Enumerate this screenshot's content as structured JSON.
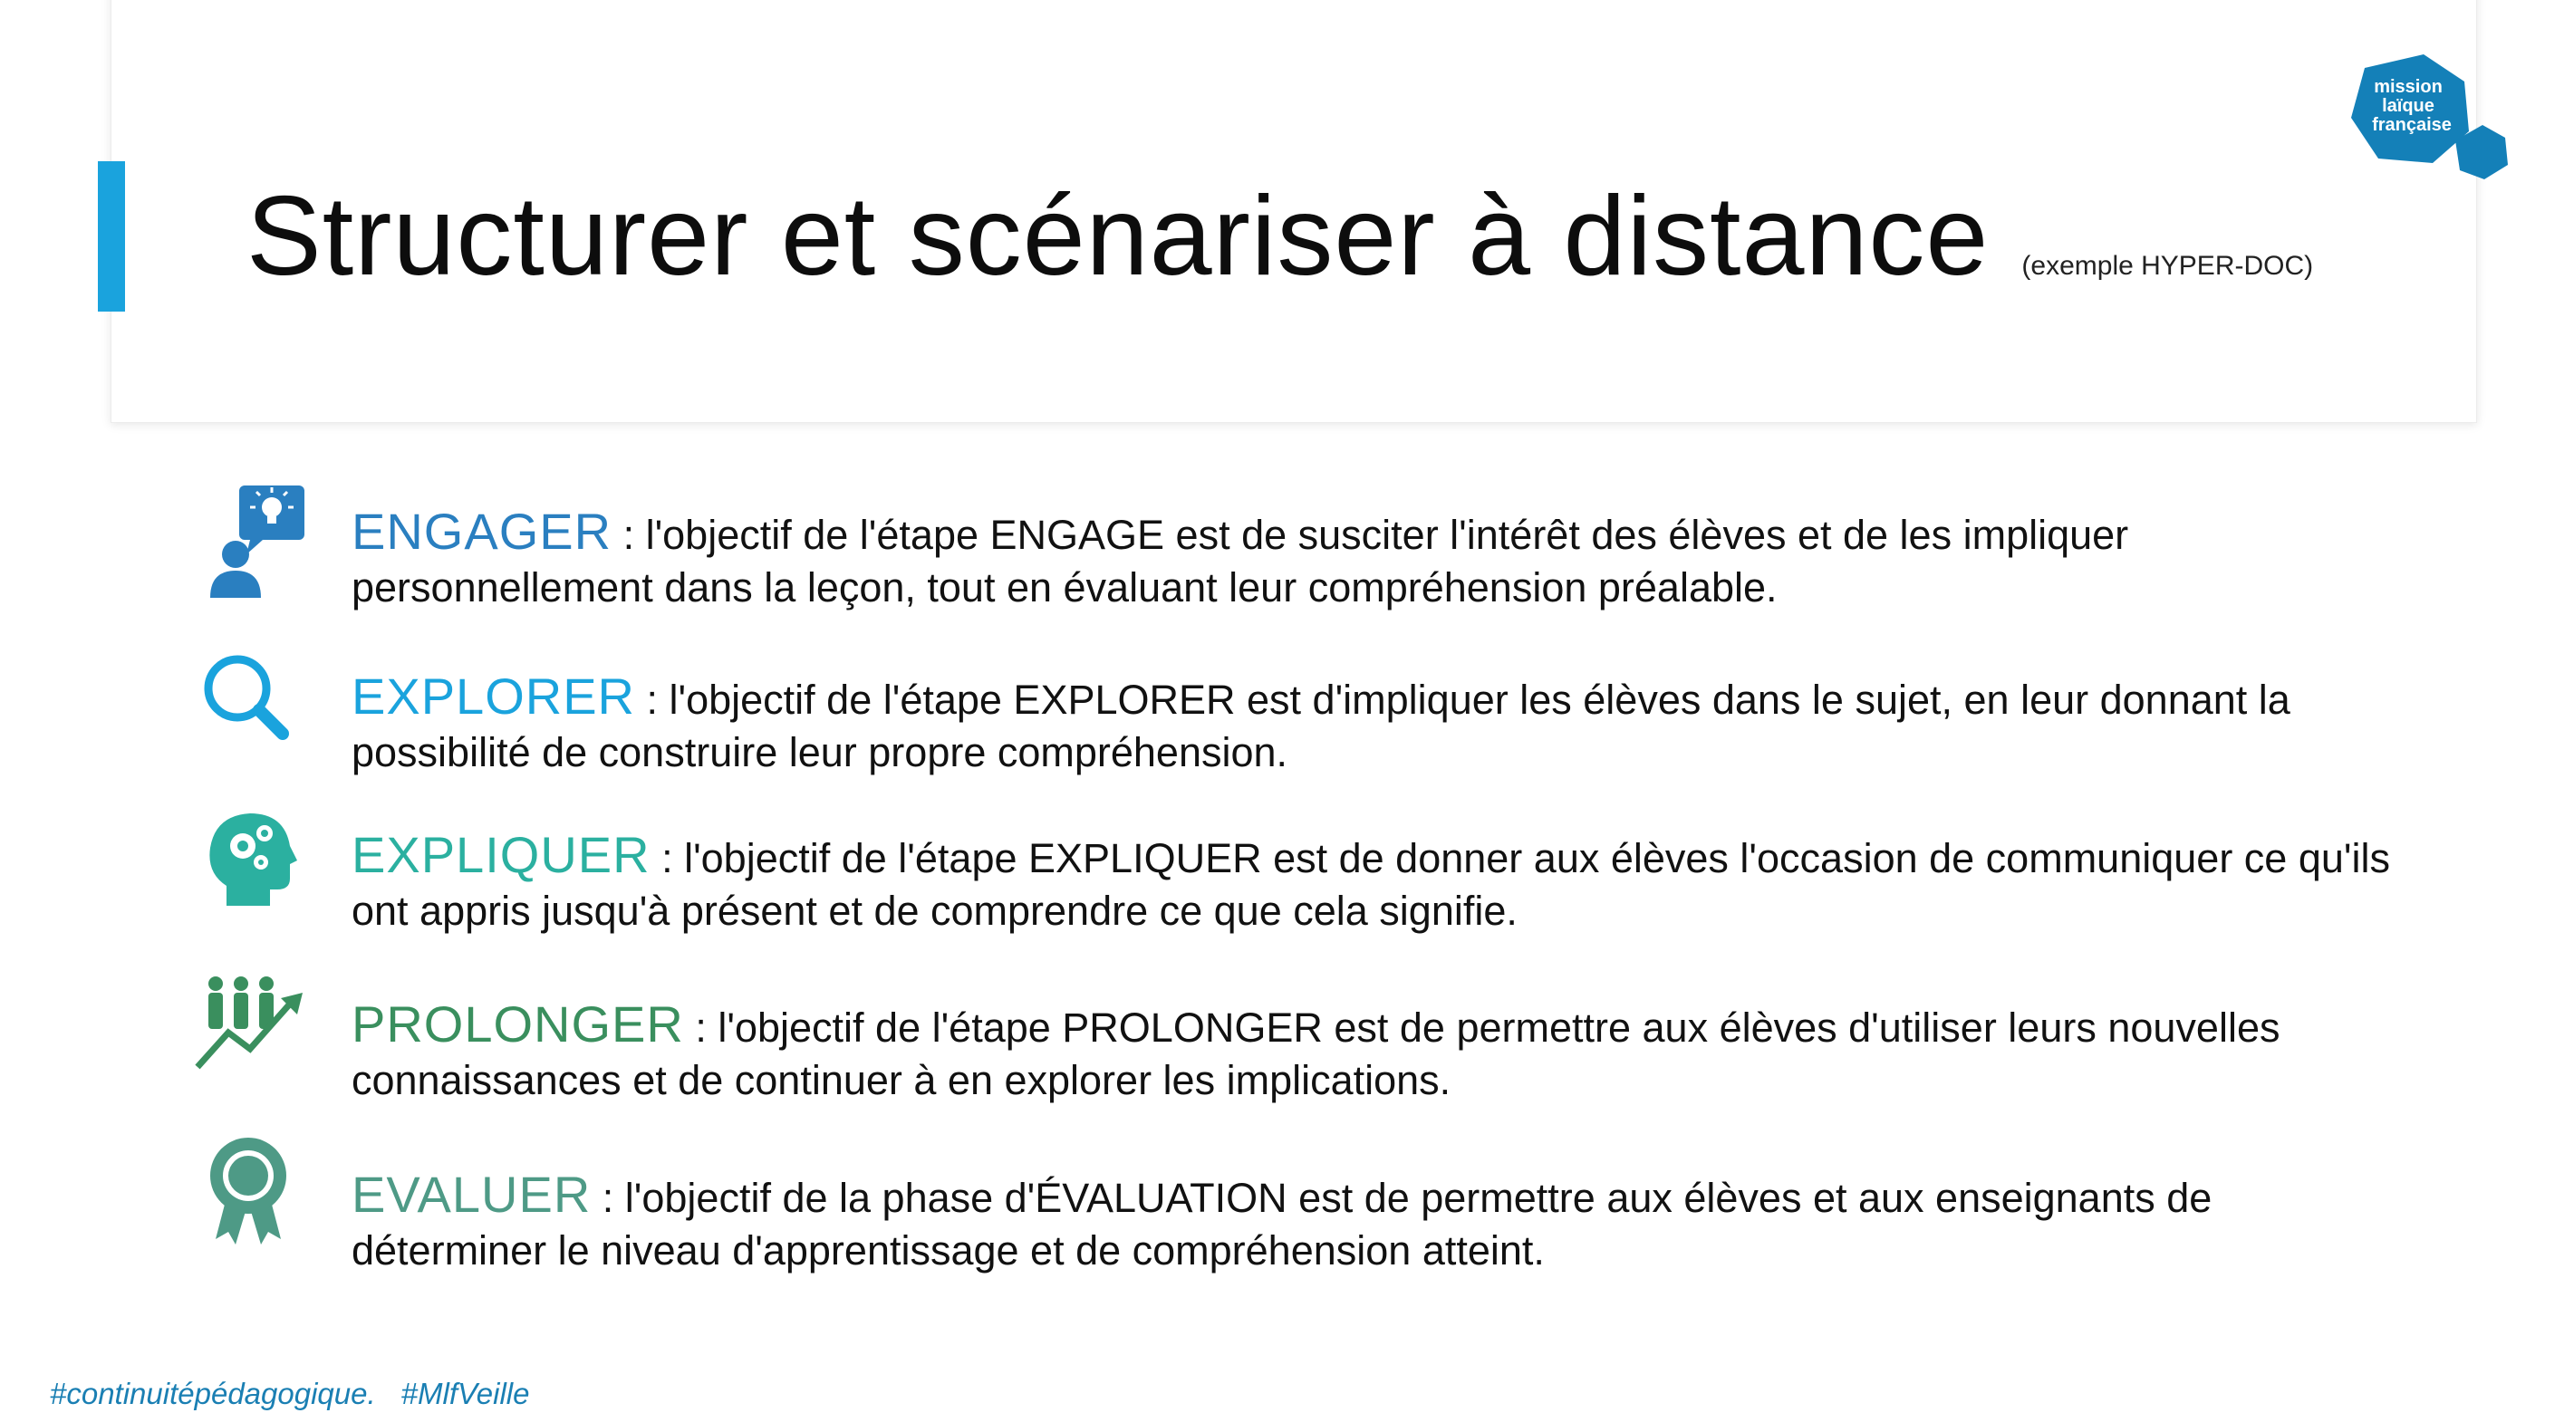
{
  "title": {
    "main": "Structurer et scénariser à distance",
    "sub": "(exemple HYPER-DOC)"
  },
  "logo": {
    "line1": "mission",
    "line2": "laïque",
    "line3": "française",
    "color": "#1480b8"
  },
  "items": [
    {
      "keyword": "ENGAGER",
      "color": "#2a7fc0",
      "icon": "person-idea-icon",
      "text": " : l'objectif de l'étape ENGAGE est de susciter l'intérêt des élèves et de les impliquer personnellement dans la leçon, tout en évaluant leur compréhension préalable."
    },
    {
      "keyword": "EXPLORER",
      "color": "#1aa3dd",
      "icon": "magnifier-icon",
      "text": " : l'objectif de l'étape EXPLORER est d'impliquer les élèves dans le sujet, en leur donnant la possibilité de construire leur propre compréhension."
    },
    {
      "keyword": "EXPLIQUER",
      "color": "#2bb0a0",
      "icon": "head-gears-icon",
      "text": " : l'objectif de l'étape EXPLIQUER est de donner aux élèves l'occasion de communiquer ce qu'ils ont appris jusqu'à présent et de comprendre ce que cela signifie."
    },
    {
      "keyword": "PROLONGER",
      "color": "#3a8f5e",
      "icon": "team-growth-icon",
      "text": " : l'objectif de l'étape PROLONGER est de permettre aux élèves d'utiliser leurs nouvelles connaissances et de continuer à en explorer les implications."
    },
    {
      "keyword": "EVALUER",
      "color": "#4e9a86",
      "icon": "award-badge-icon",
      "text": " : l'objectif de la phase d'ÉVALUATION est de permettre aux élèves et aux enseignants de déterminer le niveau d'apprentissage et de compréhension atteint."
    }
  ],
  "footer": {
    "tag1": "#continuitépédagogique.",
    "tag2": "#MlfVeille"
  }
}
